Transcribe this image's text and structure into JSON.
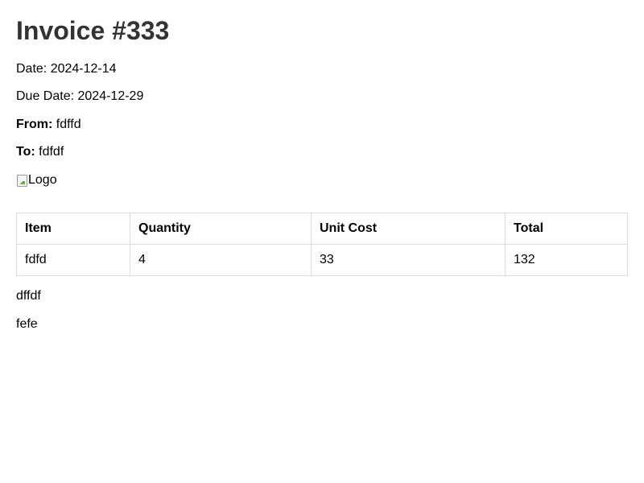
{
  "invoice": {
    "title": "Invoice #333",
    "date_label": "Date:",
    "date": "2024-12-14",
    "due_label": "Due Date:",
    "due_date": "2024-12-29",
    "from_label": "From:",
    "from": "fdffd",
    "to_label": "To:",
    "to": "fdfdf",
    "logo_alt": "Logo",
    "logo_icon": "broken-image-icon"
  },
  "table": {
    "headers": [
      "Item",
      "Quantity",
      "Unit Cost",
      "Total"
    ],
    "rows": [
      [
        "fdfd",
        "4",
        "33",
        "132"
      ]
    ]
  },
  "notes": [
    "dffdf",
    "fefe"
  ]
}
